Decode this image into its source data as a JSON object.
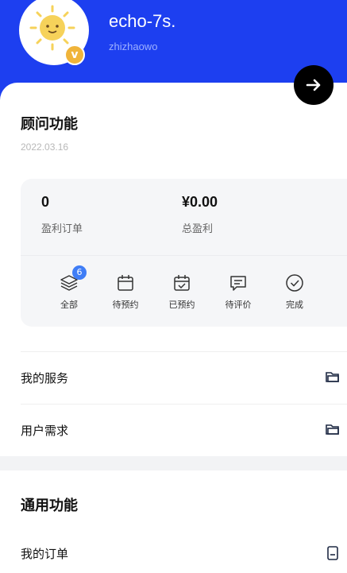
{
  "profile": {
    "name": "echo-7s.",
    "handle": "zhizhaowo",
    "badge": "v"
  },
  "consultant": {
    "title": "顾问功能",
    "date": "2022.03.16",
    "stats": [
      {
        "value": "0",
        "label": "盈利订单"
      },
      {
        "value": "¥0.00",
        "label": "总盈利"
      }
    ],
    "tabs": [
      {
        "label": "全部",
        "icon": "layers-icon",
        "badge": "6"
      },
      {
        "label": "待预约",
        "icon": "calendar-icon"
      },
      {
        "label": "已预约",
        "icon": "calendar-check-icon"
      },
      {
        "label": "待评价",
        "icon": "comment-icon"
      },
      {
        "label": "完成",
        "icon": "check-circle-icon"
      }
    ],
    "menu": [
      {
        "label": "我的服务",
        "icon": "folder-icon"
      },
      {
        "label": "用户需求",
        "icon": "folder-icon"
      }
    ]
  },
  "general": {
    "title": "通用功能",
    "menu": [
      {
        "label": "我的订单",
        "icon": "document-icon"
      }
    ]
  },
  "colors": {
    "header": "#1d3ff0",
    "badge": "#3f7df6",
    "vip": "#f0b43a"
  }
}
